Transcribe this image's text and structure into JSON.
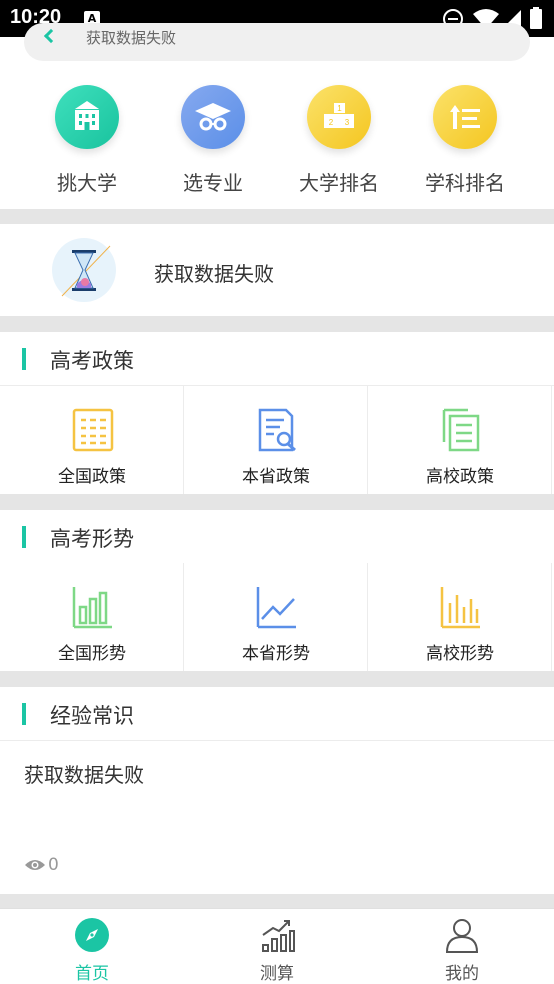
{
  "status_bar": {
    "time": "10:20",
    "a_icon": "A",
    "icons": [
      "do-not-disturb-icon",
      "wifi-icon",
      "cell-signal-icon",
      "battery-icon"
    ]
  },
  "search": {
    "text": "获取数据失败"
  },
  "quick_nav": [
    {
      "label": "挑大学",
      "icon": "university-building-icon",
      "color": "#1fcfa9"
    },
    {
      "label": "选专业",
      "icon": "graduation-cap-icon",
      "color": "#5b8fe8"
    },
    {
      "label": "大学排名",
      "icon": "podium-ranking-icon",
      "color": "#f7cf2e"
    },
    {
      "label": "学科排名",
      "icon": "sort-list-icon",
      "color": "#f7cf2e"
    }
  ],
  "banner": {
    "text": "获取数据失败",
    "icon": "hourglass-icon"
  },
  "policy_section": {
    "title": "高考政策",
    "items": [
      {
        "label": "全国政策",
        "icon": "national-policy-icon",
        "color": "#f5c342"
      },
      {
        "label": "本省政策",
        "icon": "province-policy-icon",
        "color": "#5b8fe8"
      },
      {
        "label": "高校政策",
        "icon": "college-policy-icon",
        "color": "#7ed886"
      }
    ]
  },
  "trend_section": {
    "title": "高考形势",
    "items": [
      {
        "label": "全国形势",
        "icon": "bar-chart-icon",
        "color": "#7ed886"
      },
      {
        "label": "本省形势",
        "icon": "line-chart-icon",
        "color": "#5b8fe8"
      },
      {
        "label": "高校形势",
        "icon": "column-chart-icon",
        "color": "#f5c342"
      }
    ]
  },
  "experience_section": {
    "title": "经验常识",
    "text": "获取数据失败",
    "views": "0"
  },
  "bottom_nav": [
    {
      "label": "首页",
      "icon": "compass-icon",
      "active": true
    },
    {
      "label": "测算",
      "icon": "growth-chart-icon",
      "active": false
    },
    {
      "label": "我的",
      "icon": "user-icon",
      "active": false
    }
  ],
  "colors": {
    "accent": "#1bc5a4",
    "divider": "#e5e5e5"
  }
}
